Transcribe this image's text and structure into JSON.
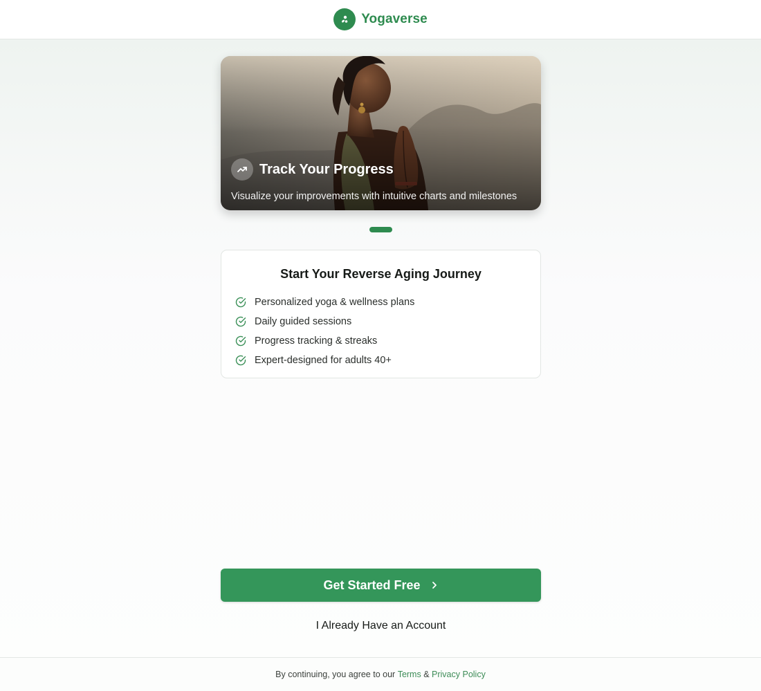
{
  "header": {
    "brand": "Yogaverse",
    "logo_icon": "leaf-drops-icon"
  },
  "hero": {
    "icon": "trending-up-icon",
    "title": "Track Your Progress",
    "description": "Visualize your improvements with intuitive charts and milestones",
    "image_subject": "woman-meditating-photo"
  },
  "carousel": {
    "active_index": 0,
    "count": 1
  },
  "benefits": {
    "title": "Start Your Reverse Aging Journey",
    "items": [
      "Personalized yoga & wellness plans",
      "Daily guided sessions",
      "Progress tracking & streaks",
      "Expert-designed for adults 40+"
    ],
    "item_icon": "check-circle-icon"
  },
  "actions": {
    "primary_label": "Get Started Free",
    "primary_icon": "chevron-right-icon",
    "secondary_label": "I Already Have an Account"
  },
  "footer": {
    "prefix": "By continuing, you agree to our",
    "terms": "Terms",
    "amp": "&",
    "privacy": "Privacy Policy"
  },
  "colors": {
    "brand_green": "#2e8b4f",
    "button_green": "#34965a",
    "link_green": "#3d8c57"
  }
}
